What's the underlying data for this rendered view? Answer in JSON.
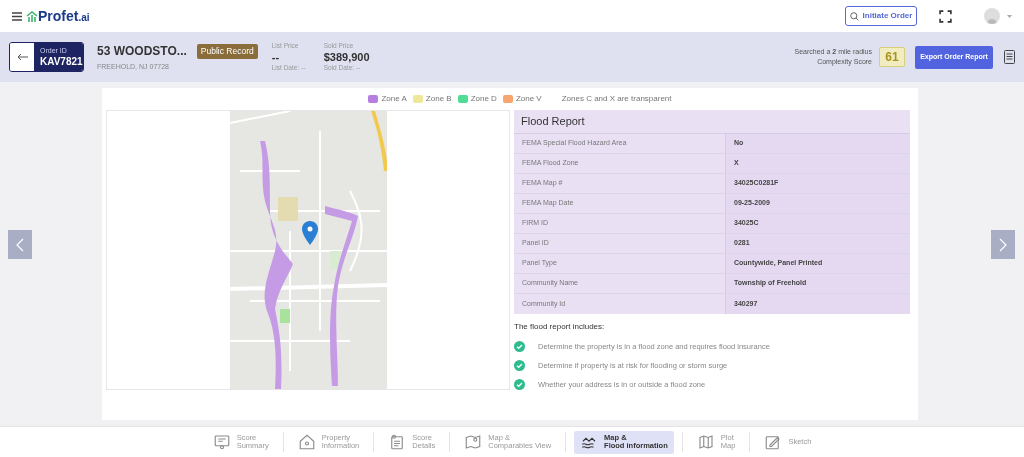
{
  "brand": {
    "name": "Profet",
    "suffix": ".ai"
  },
  "topbar": {
    "initiate_button": "Initiate Order"
  },
  "order": {
    "id_label": "Order ID",
    "id": "KAV7821",
    "address": "53 WOODSTO...",
    "city": "FREEHOLD, NJ 07728",
    "badge": "Public Record",
    "list_price_label": "List Price",
    "list_price": "--",
    "list_date": "List Date: --",
    "sold_price_label": "Sold Price",
    "sold_price": "$389,900",
    "sold_date": "Sold Date: --"
  },
  "complexity": {
    "searched": "Searched a **2** mile radius",
    "label": "Complexity Score",
    "score": "61",
    "export_button": "Export Order Report"
  },
  "legend": {
    "items": [
      {
        "label": "Zone A",
        "color": "#b57ee0"
      },
      {
        "label": "Zone B",
        "color": "#efe89a"
      },
      {
        "label": "Zone D",
        "color": "#4fdc94"
      },
      {
        "label": "Zone V",
        "color": "#f7a46e"
      }
    ],
    "note": "Zones C and X are transparent"
  },
  "flood_report": {
    "title": "Flood Report",
    "rows": [
      {
        "label": "FEMA Special Flood Hazard Area",
        "value": "No"
      },
      {
        "label": "FEMA Flood Zone",
        "value": "X"
      },
      {
        "label": "FEMA Map #",
        "value": "34025C0281F"
      },
      {
        "label": "FEMA Map Date",
        "value": "09-25-2009"
      },
      {
        "label": "FIRM ID",
        "value": "34025C"
      },
      {
        "label": "Panel ID",
        "value": "0281"
      },
      {
        "label": "Panel Type",
        "value": "Countywide, Panel Printed"
      },
      {
        "label": "Community Name",
        "value": "Township of Freehold"
      },
      {
        "label": "Community Id",
        "value": "340297"
      }
    ],
    "includes_title": "The flood report includes:",
    "includes": [
      "Determine the property is in a flood zone and requires flood insurance",
      "Determine if property is at risk for flooding or storm surge",
      "Whether your address is in or outside a flood zone"
    ]
  },
  "bottom_nav": [
    {
      "line1": "Score",
      "line2": "Summary",
      "kind": "summary",
      "selected": false
    },
    {
      "line1": "Property",
      "line2": "Information",
      "kind": "home",
      "selected": false
    },
    {
      "line1": "Score",
      "line2": "Details",
      "kind": "details",
      "selected": false
    },
    {
      "line1": "Map &",
      "line2": "Comparables View",
      "kind": "map",
      "selected": false
    },
    {
      "line1": "Map &",
      "line2": "Flood information",
      "kind": "flood",
      "selected": true
    },
    {
      "line1": "Plot",
      "line2": "Map",
      "kind": "plot",
      "selected": false
    },
    {
      "line1": "Sketch",
      "kind": "sketch",
      "selected": false
    }
  ]
}
